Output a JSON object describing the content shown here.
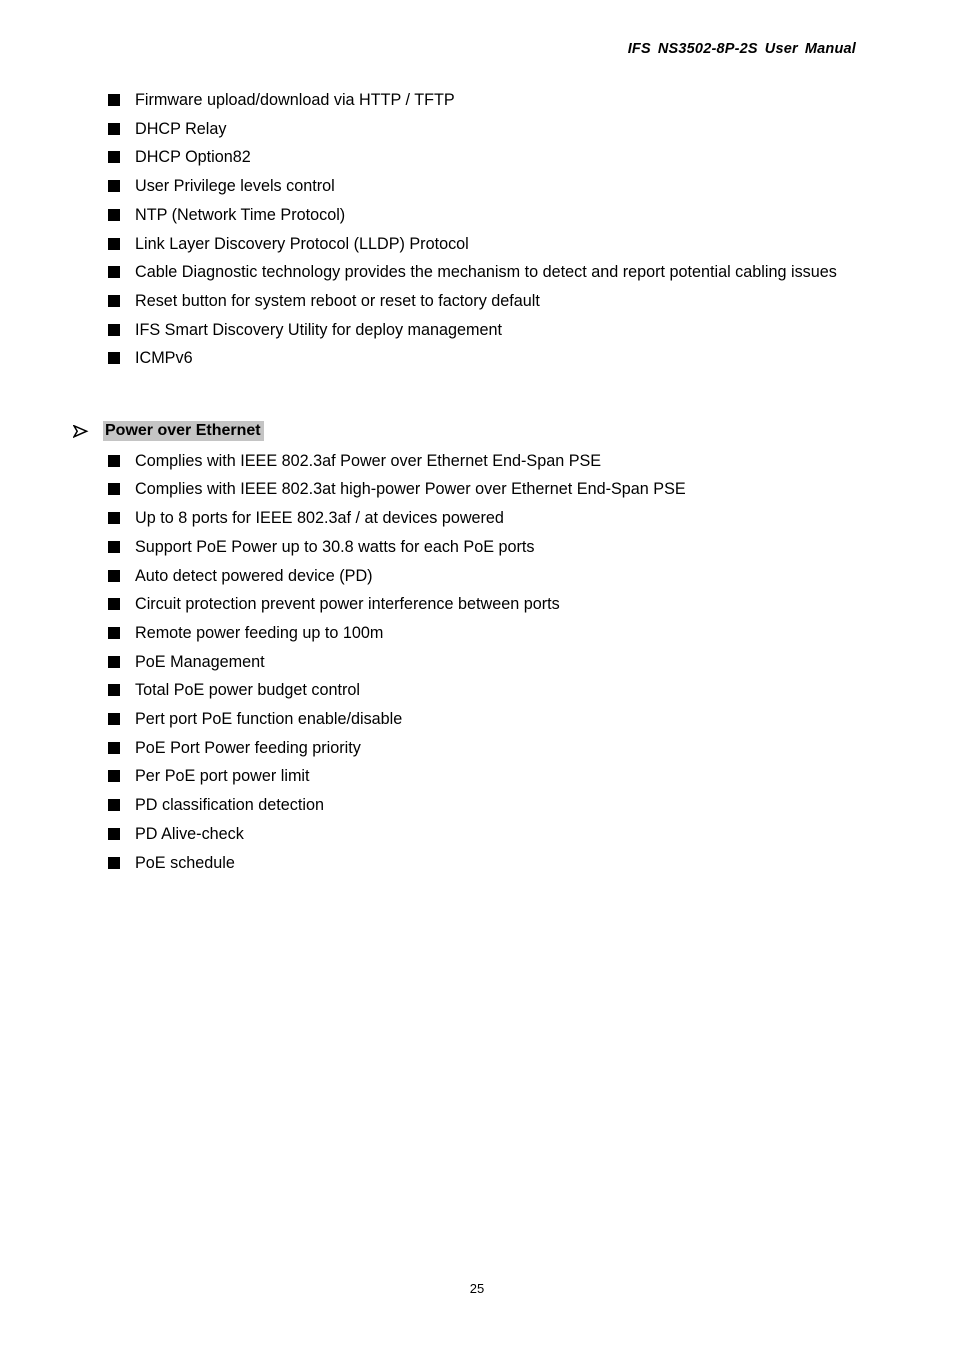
{
  "header": {
    "words": [
      "IFS",
      "NS3502-8P-2S",
      "User",
      "Manual"
    ],
    "full_text": "IFS  NS3502-8P-2S  User  Manual"
  },
  "management_features": {
    "items": [
      "Firmware upload/download via HTTP / TFTP",
      "DHCP Relay",
      "DHCP Option82",
      "User Privilege levels control",
      "NTP (Network Time Protocol)",
      "Link Layer Discovery Protocol (LLDP) Protocol",
      "Cable Diagnostic technology provides the mechanism to detect and report potential cabling issues",
      "Reset button for system reboot or reset to factory default",
      "IFS Smart Discovery Utility for deploy management",
      "ICMPv6"
    ]
  },
  "poe_section": {
    "heading": "Power over Ethernet",
    "heading_highlight_color": "#c4c4c4",
    "arrow_icon": "arrow-right-triangle-icon",
    "items": [
      "Complies with IEEE 802.3af Power over Ethernet End-Span PSE",
      "Complies with IEEE 802.3at high-power Power over Ethernet End-Span PSE",
      "Up to 8 ports for IEEE 802.3af / at devices powered",
      "Support PoE Power up to 30.8 watts for each PoE ports",
      "Auto detect powered device (PD)",
      "Circuit protection prevent power interference between ports",
      "Remote power feeding up to 100m",
      "PoE Management",
      "Total PoE power budget control",
      "Pert port PoE function enable/disable",
      "PoE Port Power feeding priority",
      "Per PoE port power limit",
      "PD classification detection",
      "PD Alive-check",
      "PoE schedule"
    ]
  },
  "footer": {
    "page_number": "25"
  }
}
